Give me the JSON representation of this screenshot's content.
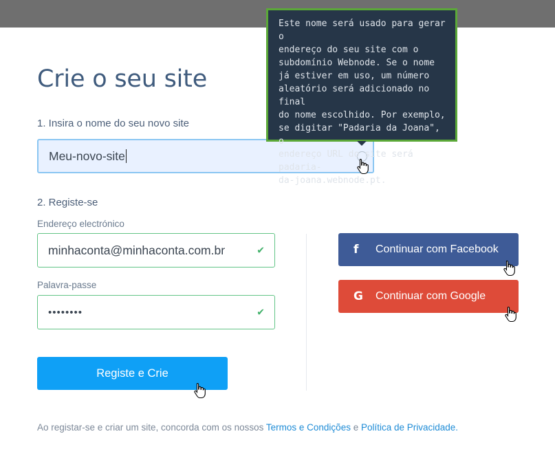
{
  "page": {
    "title": "Crie o seu site",
    "step1_label": "1. Insira o nome do seu novo site",
    "site_name_value": "Meu-novo-site",
    "step2_label": "2. Registe-se",
    "email_label": "Endereço electrónico",
    "email_value": "minhaconta@minhaconta.com.br",
    "password_label": "Palavra-passe",
    "password_value": "••••••••",
    "submit_label": "Registe e Crie"
  },
  "tooltip": {
    "text": "Este nome será usado para gerar o endereço do seu site com o subdomínio Webnode. Se o nome já estiver em uso, um número aleatório será adicionado no final do nome escolhido. Por exemplo, se digitar \"Padaria da Joana\", o endereço URL do site será padaria-da-joana.webnode.pt.",
    "lines": [
      "Este nome será usado para gerar o",
      "endereço do seu site com o",
      "subdomínio Webnode. Se o nome",
      "já estiver em uso, um número",
      "aleatório será adicionado no final",
      "do nome escolhido. Por exemplo,",
      "se digitar \"Padaria da Joana\", o",
      "endereço URL do site será padaria-",
      "da-joana.webnode.pt."
    ]
  },
  "social": {
    "facebook_label": "Continuar com Facebook",
    "google_label": "Continuar com Google",
    "facebook_icon": "f",
    "google_icon": "G"
  },
  "footer": {
    "prefix": "Ao registar-se e criar um site, concorda com os nossos ",
    "terms_link": "Termos e Condições",
    "conjunction": " e ",
    "privacy_link": "Política de Privacidade."
  },
  "colors": {
    "title": "#3f5b7d",
    "facebook": "#3e5b97",
    "google": "#de4b39",
    "primary": "#0fa0f6",
    "valid": "#62c486"
  }
}
